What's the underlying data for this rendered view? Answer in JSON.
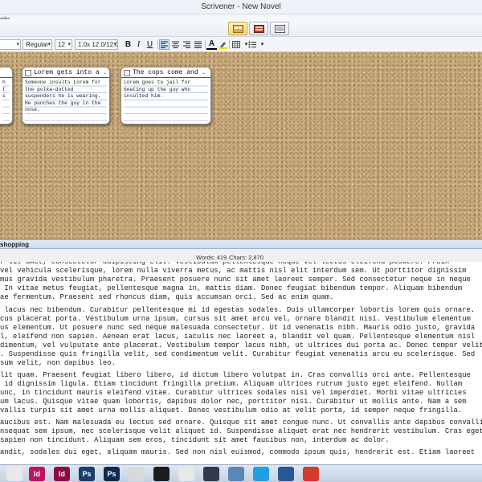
{
  "window": {
    "title": "Scrivener - New Novel"
  },
  "menu": {
    "visible_fragment": "elp"
  },
  "view_buttons": [
    {
      "name": "corkboard-view",
      "active": true
    },
    {
      "name": "outline-view",
      "active": false
    },
    {
      "name": "scrivenings-view",
      "active": false
    }
  ],
  "format_bar": {
    "style_value": "Regular",
    "size_value": "12",
    "spacing_value": "1.0x 12.0/12.0",
    "bold": "B",
    "italic": "I",
    "underline": "U",
    "text_color": "A"
  },
  "corkboard": {
    "cards": [
      {
        "title": "",
        "body": "h\nt\ns\n"
      },
      {
        "title": "Lorem gets into a ...",
        "body": "Someone insults Lorem for\nthe polka-dotted suspenders\nhe is wearing. He punches\nthe guy in the nose."
      },
      {
        "title": "The cops come and ...",
        "body": "Lorem goes to jail for\nbeating up the guy who\ninsulted him."
      }
    ]
  },
  "editor_header": {
    "document_title": "shopping"
  },
  "status": {
    "words": "Words: 419",
    "chars": "Chars: 2,870"
  },
  "editor": {
    "paragraphs": [
      "r sit amet, consectetur adipiscing elit. Vestibulum pellentesque neque vel lectus eleifend posuere. Proin\nvel vehicula scelerisque, lorem nulla viverra metus, ac mattis nisl elit interdum sem. Ut porttitor dignissim\nmus gravida vestibulum pharetra. Praesent posuere nunc sit amet laoreet semper. Sed consectetur neque in neque\n In vitae metus feugiat, pellentesque magna in, mattis diam. Donec feugiat bibendum tempor. Aliquam bibendum\nae fermentum. Praesent sed rhoncus diam, quis accumsan orci. Sed ac enim quam.",
      " lacus nec bibendum. Curabitur pellentesque mi id egestas sodales. Duis ullamcorper lobortis lorem quis ornare.\ncus placerat porta. Vestibulum urna ipsum, cursus sit amet arcu vel, ornare blandit nisi. Vestibulum elementum\nus elementum. Ut posuere nunc sed neque malesuada consectetur. Ut id venenatis nibh. Mauris odio justo, gravida\nl, eleifend non sapien. Aenean erat lacus, iaculis nec laoreet a, blandit vel quam. Pellentesque elementum nisl\ndimentum, vel vulputate ante placerat. Vestibulum tempor lacus nibh, ut ultrices dui porta ac. Donec tempor velit\n. Suspendisse quis fringilla velit, sed condimentum velit. Curabitur feugiat venenatis arcu eu scelerisque. Sed\nsum velit, non dapibus leo.",
      "lit quam. Praesent feugiat libero libero, id dictum libero volutpat in. Cras convallis orci ante. Pellentesque\n id dignissim ligula. Etiam tincidunt fringilla pretium. Aliquam ultrices rutrum justo eget eleifend. Nullam\nunc, in tincidunt mauris eleifend vitae. Curabitur ultrices sodales nisi vel imperdiet. Morbi vitae ultricies\num lacus. Quisque vitae quam lobortis, dapibus dolor nec, porttitor nisi. Curabitur ut mollis ante. Nam a sem\nvallis turpis sit amet urna mollis aliquet. Donec vestibulum odio at velit porta, id semper neque fringilla.",
      "aucibus est. Nam malesuada eu lectus sed ornare. Quisque sit amet congue nunc. Ut convallis ante dapibus convallis.\nnsequat sem ipsum, nec scelerisque velit aliquet id. Suspendisse aliquet erat nec hendrerit vestibulum. Cras eget\nsapien non tincidunt. Aliquam sem eros, tincidunt sit amet faucibus non, interdum ac dolor.",
      "andit, sodales dui eget, aliquam mauris. Sed non nisl euismod, commodo ipsum quis, hendrerit est. Etiam laoreet"
    ]
  },
  "taskbar": {
    "apps": [
      {
        "name": "indesign-app",
        "label": "Id",
        "color": "#c0155b"
      },
      {
        "name": "indesign-app-2",
        "label": "Id",
        "color": "#8e0c42"
      },
      {
        "name": "photoshop-app",
        "label": "Ps",
        "color": "#1a3c6e"
      },
      {
        "name": "photoshop-app-2",
        "label": "Ps",
        "color": "#0f2b52"
      },
      {
        "name": "chrome-app",
        "label": "",
        "color": "#d9d9d9"
      },
      {
        "name": "terminal-app",
        "label": "",
        "color": "#1d1d1d"
      },
      {
        "name": "yinyang-app",
        "label": "",
        "color": "#e8e8e8"
      },
      {
        "name": "scrivener-app",
        "label": "",
        "color": "#303a4a"
      },
      {
        "name": "explorer-app",
        "label": "",
        "color": "#5b86b8"
      },
      {
        "name": "skype-app",
        "label": "",
        "color": "#1fa0e3"
      },
      {
        "name": "word-app",
        "label": "",
        "color": "#2b5797"
      },
      {
        "name": "ladybug-app",
        "label": "",
        "color": "#d13c2f"
      }
    ]
  }
}
